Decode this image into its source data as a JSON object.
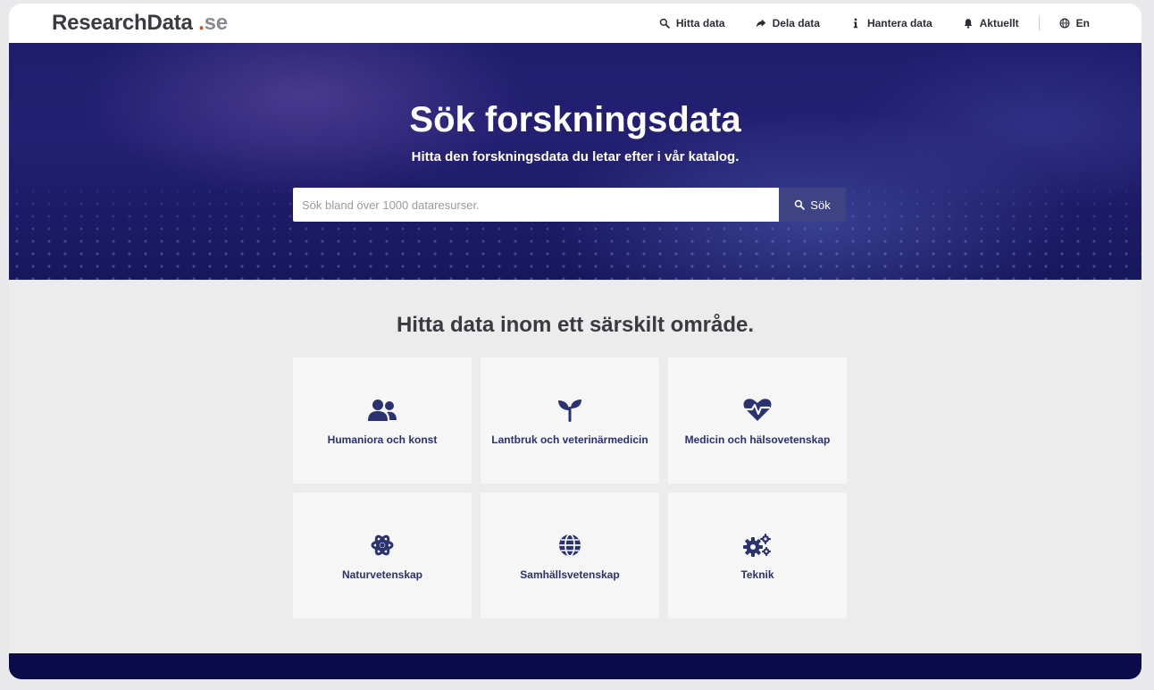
{
  "logo": {
    "main": "ResearchData",
    "dot": ".",
    "tld": "se"
  },
  "nav": [
    {
      "label": "Hitta data",
      "icon": "search-icon"
    },
    {
      "label": "Dela data",
      "icon": "share-icon"
    },
    {
      "label": "Hantera data",
      "icon": "info-icon"
    },
    {
      "label": "Aktuellt",
      "icon": "bell-icon"
    }
  ],
  "lang": {
    "label": "En",
    "icon": "globe-icon"
  },
  "hero": {
    "title": "Sök forskningsdata",
    "subtitle": "Hitta den forskningsdata du letar efter i vår katalog."
  },
  "search": {
    "placeholder": "Sök bland över 1000 dataresurser.",
    "value": "",
    "button_label": "Sök"
  },
  "areas": {
    "title": "Hitta data inom ett särskilt område.",
    "items": [
      {
        "label": "Humaniora och konst",
        "icon": "users-icon"
      },
      {
        "label": "Lantbruk och veterinärmedicin",
        "icon": "seedling-icon"
      },
      {
        "label": "Medicin och hälsovetenskap",
        "icon": "heart-pulse-icon"
      },
      {
        "label": "Naturvetenskap",
        "icon": "atom-icon"
      },
      {
        "label": "Samhällsvetenskap",
        "icon": "globe-icon"
      },
      {
        "label": "Teknik",
        "icon": "gears-icon"
      }
    ]
  },
  "colors": {
    "accent": "#3d4383",
    "card_text": "#2b3270",
    "logo_dot": "#d9472b",
    "hero_bg": "#1f1d6e",
    "footer_bg": "#0b0b4a"
  }
}
